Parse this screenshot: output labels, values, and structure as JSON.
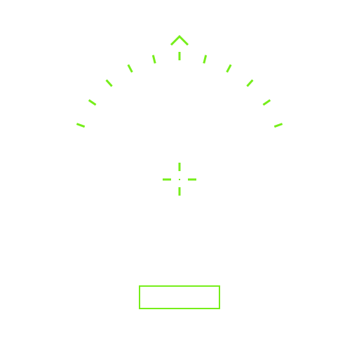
{
  "hud": {
    "accent_color": "#76ee1a",
    "background_color": "#ffffff",
    "heading_indicator": {
      "icon": "chevron-up-icon",
      "tick_count": 11
    },
    "crosshair": {
      "icon": "crosshair-icon"
    },
    "status_box": {
      "text": ""
    }
  }
}
